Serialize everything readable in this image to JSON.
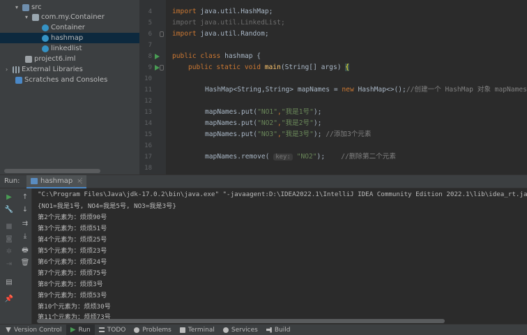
{
  "project_tree": {
    "items": [
      {
        "label": "src",
        "icon": "folder-icon"
      },
      {
        "label": "com.my.Container",
        "icon": "package-icon"
      },
      {
        "label": "Container",
        "icon": "java-class-icon"
      },
      {
        "label": "hashmap",
        "icon": "java-class-icon"
      },
      {
        "label": "linkedlist",
        "icon": "java-class-icon"
      },
      {
        "label": "project6.iml",
        "icon": "module-file-icon"
      },
      {
        "label": "External Libraries",
        "icon": "libraries-icon"
      },
      {
        "label": "Scratches and Consoles",
        "icon": "scratches-icon"
      }
    ],
    "selected": "hashmap"
  },
  "editor": {
    "line_numbers": [
      "4",
      "5",
      "6",
      "7",
      "8",
      "9",
      "10",
      "11",
      "12",
      "13",
      "14",
      "15",
      "16",
      "17",
      "18"
    ],
    "lines": {
      "l4_kw": "import",
      "l4_rest": " java.util.HashMap;",
      "l5_kw": "import",
      "l5_rest": " java.util.LinkedList;",
      "l6_kw": "import",
      "l6_rest": " java.util.Random;",
      "l8_kw": "public class",
      "l8_rest": " hashmap {",
      "l9_kw": "public static void",
      "l9_fn": "main",
      "l9_rest": "(String[] args) ",
      "l9_brace": "{",
      "l11_a": "HashMap<String,String> mapNames = ",
      "l11_kw": "new",
      "l11_b": " HashMap<>();",
      "l11_cm": "//创建一个 HashMap 对象 mapNames",
      "l13_a": "mapNames.put(",
      "l13_s1": "\"NO1\"",
      "l13_c": ",",
      "l13_s2": "\"我是1号\"",
      "l13_e": ");",
      "l14_a": "mapNames.put(",
      "l14_s1": "\"NO2\"",
      "l14_c": ",",
      "l14_s2": "\"我是2号\"",
      "l14_e": ");",
      "l15_a": "mapNames.put(",
      "l15_s1": "\"NO3\"",
      "l15_c": ",",
      "l15_s2": "\"我是3号\"",
      "l15_e": "); ",
      "l15_cm": "//添加3个元素",
      "l17_a": "mapNames.remove( ",
      "l17_hint": "key:",
      "l17_s": " \"NO2\"",
      "l17_e": ");    ",
      "l17_cm": "//删除第二个元素"
    }
  },
  "run_panel": {
    "label": "Run:",
    "tab_label": "hashmap",
    "close_glyph": "×",
    "more_glyph": "⋮",
    "output": [
      "\"C:\\Program Files\\Java\\jdk-17.0.2\\bin\\java.exe\" \"-javaagent:D:\\IDEA2022.1\\IntelliJ IDEA Community Edition 2022.1\\lib\\idea_rt.jar",
      "{NO1=我是1号, NO4=我是5号, NO3=我是3号}",
      "第2个元素为：烦烦90号",
      "第3个元素为：烦烦51号",
      "第4个元素为：烦烦25号",
      "第5个元素为：烦烦23号",
      "第6个元素为：烦烦24号",
      "第7个元素为：烦烦75号",
      "第8个元素为：烦烦3号",
      "第9个元素为：烦烦53号",
      "第10个元素为：烦烦30号",
      "第11个元素为：烦烦73号"
    ]
  },
  "bottom_bar": {
    "version_control": "Version Control",
    "run": "Run",
    "todo": "TODO",
    "problems": "Problems",
    "terminal": "Terminal",
    "services": "Services",
    "build": "Build"
  },
  "colors": {
    "background": "#2b2b2b",
    "panel": "#3c3f41",
    "keyword": "#cc7832",
    "string": "#6a8759",
    "comment": "#808080",
    "method": "#ffc66d",
    "accent": "#4a88c7",
    "run_green": "#499c54"
  }
}
